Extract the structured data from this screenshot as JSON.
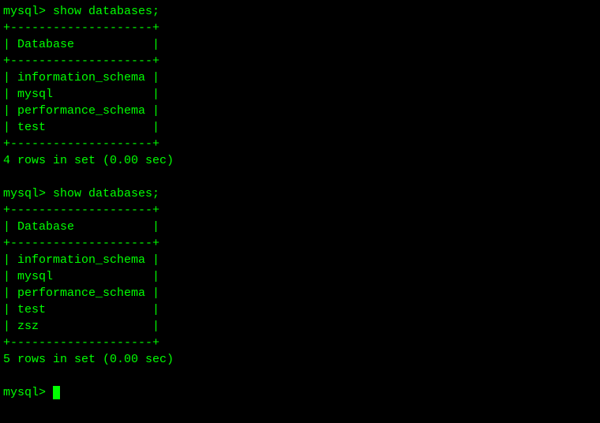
{
  "session1": {
    "prompt": "mysql> ",
    "command": "show databases;",
    "border_top": "+--------------------+",
    "header_row": "| Database           |",
    "border_mid": "+--------------------+",
    "rows": {
      "r0": "| information_schema |",
      "r1": "| mysql              |",
      "r2": "| performance_schema |",
      "r3": "| test               |"
    },
    "border_bot": "+--------------------+",
    "summary": "4 rows in set (0.00 sec)"
  },
  "session2": {
    "prompt": "mysql> ",
    "command": "show databases;",
    "border_top": "+--------------------+",
    "header_row": "| Database           |",
    "border_mid": "+--------------------+",
    "rows": {
      "r0": "| information_schema |",
      "r1": "| mysql              |",
      "r2": "| performance_schema |",
      "r3": "| test               |",
      "r4": "| zsz                |"
    },
    "border_bot": "+--------------------+",
    "summary": "5 rows in set (0.00 sec)"
  },
  "final_prompt": "mysql> "
}
